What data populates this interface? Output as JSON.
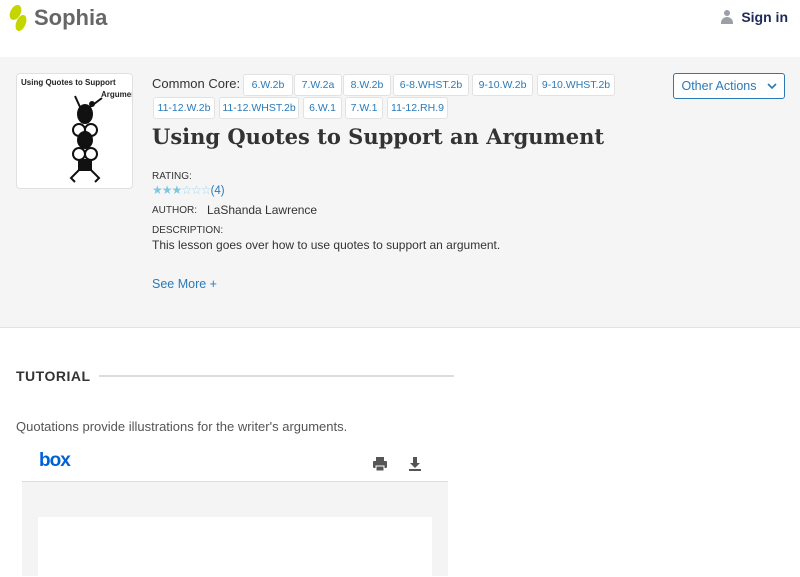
{
  "header": {
    "brand": "Sophia",
    "signin": "Sign in"
  },
  "lesson": {
    "thumbnail": {
      "line1": "Using Quotes to Support",
      "line2": "Arguments"
    },
    "common_core_label": "Common Core:",
    "tags": [
      "6.W.2b",
      "7.W.2a",
      "8.W.2b",
      "6-8.WHST.2b",
      "9-10.W.2b",
      "9-10.WHST.2b",
      "11-12.W.2b",
      "11-12.WHST.2b",
      "6.W.1",
      "7.W.1",
      "11-12.RH.9"
    ],
    "other_actions": "Other Actions",
    "title": "Using Quotes to Support an Argument",
    "rating_label": "RATING:",
    "rating": {
      "value": 3,
      "max": 6,
      "count": "(4)"
    },
    "author_label": "AUTHOR:",
    "author": "LaShanda Lawrence",
    "description_label": "DESCRIPTION:",
    "description": "This lesson goes over how to use quotes to support an argument.",
    "see_more": "See More +"
  },
  "tutorial": {
    "heading": "TUTORIAL",
    "intro": "Quotations provide illustrations for the writer's arguments.",
    "viewer_brand": "box"
  }
}
